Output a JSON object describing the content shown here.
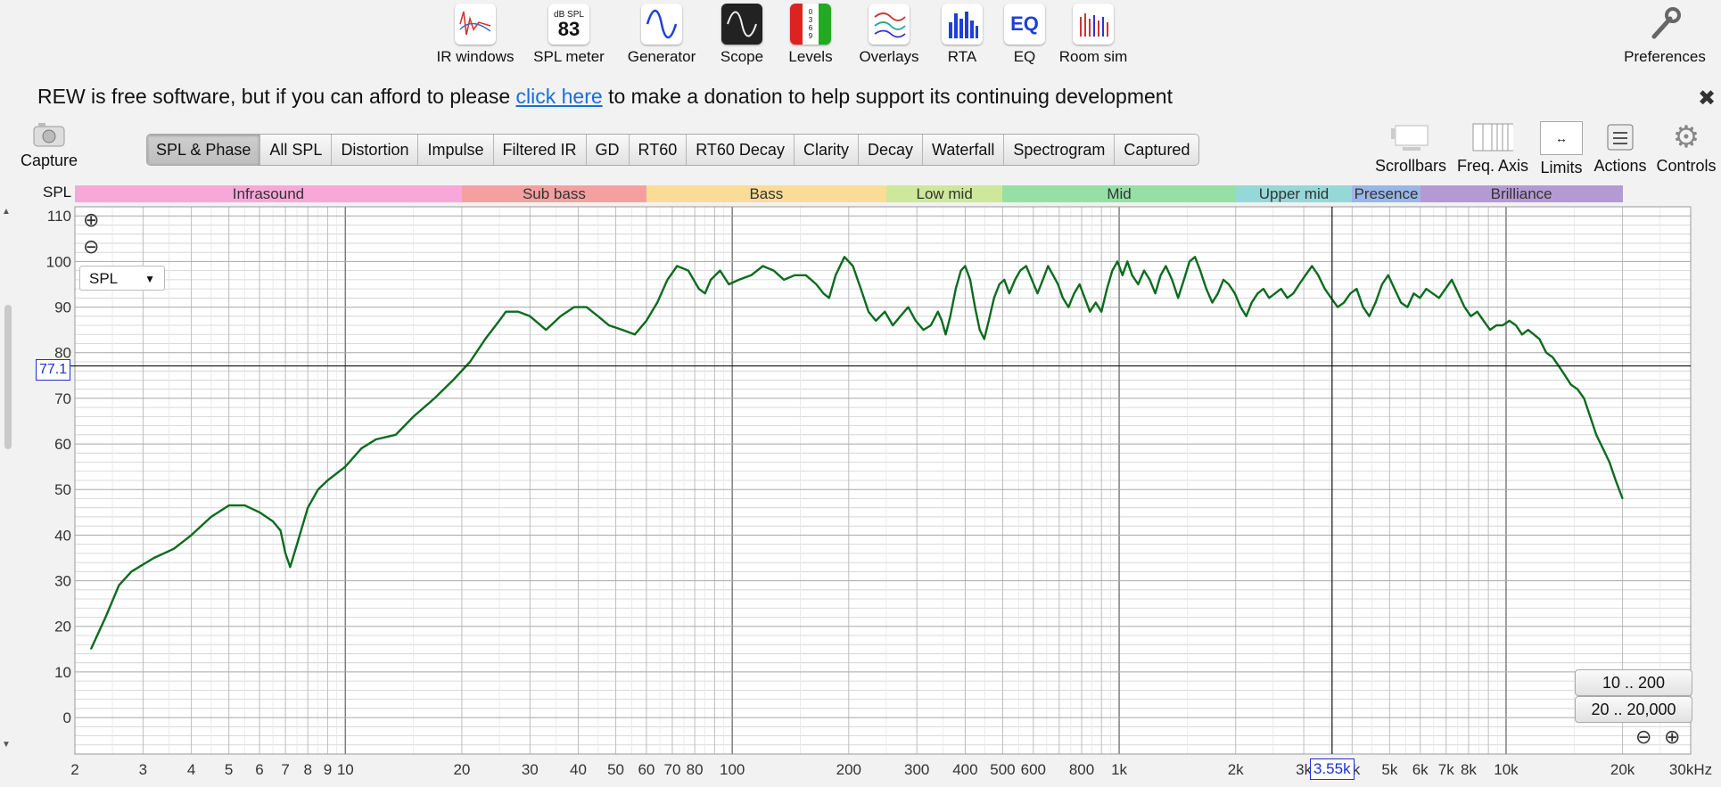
{
  "toolbar": {
    "items": [
      {
        "label": "IR windows",
        "icon": "ir-windows-icon"
      },
      {
        "label": "SPL meter",
        "icon": "spl-meter-icon",
        "icon_top": "dB SPL",
        "icon_value": "83"
      },
      {
        "label": "Generator",
        "icon": "generator-icon"
      },
      {
        "label": "Scope",
        "icon": "scope-icon"
      },
      {
        "label": "Levels",
        "icon": "levels-icon",
        "icon_digits": "0\n3\n6\n9"
      },
      {
        "label": "Overlays",
        "icon": "overlays-icon"
      },
      {
        "label": "RTA",
        "icon": "rta-icon"
      },
      {
        "label": "EQ",
        "icon": "eq-icon",
        "icon_text": "EQ"
      },
      {
        "label": "Room sim",
        "icon": "room-sim-icon"
      }
    ],
    "preferences": "Preferences"
  },
  "donation": {
    "before": "REW is free software, but if you can afford to please",
    "link": "click here",
    "after": "to make a donation to help support its continuing development"
  },
  "capture": {
    "label": "Capture"
  },
  "tabs": [
    "SPL & Phase",
    "All SPL",
    "Distortion",
    "Impulse",
    "Filtered IR",
    "GD",
    "RT60",
    "RT60 Decay",
    "Clarity",
    "Decay",
    "Waterfall",
    "Spectrogram",
    "Captured"
  ],
  "active_tab": "SPL & Phase",
  "right_tools": [
    "Scrollbars",
    "Freq. Axis",
    "Limits",
    "Actions",
    "Controls"
  ],
  "bands": [
    {
      "name": "Infrasound",
      "from": 2,
      "to": 20,
      "color": "#f7a8d8"
    },
    {
      "name": "Sub bass",
      "from": 20,
      "to": 60,
      "color": "#f5a0a0"
    },
    {
      "name": "Bass",
      "from": 60,
      "to": 250,
      "color": "#f9dd96"
    },
    {
      "name": "Low mid",
      "from": 250,
      "to": 500,
      "color": "#cde89a"
    },
    {
      "name": "Mid",
      "from": 500,
      "to": 2000,
      "color": "#96e0a6"
    },
    {
      "name": "Upper mid",
      "from": 2000,
      "to": 4000,
      "color": "#96d8d8"
    },
    {
      "name": "Presence",
      "from": 4000,
      "to": 6000,
      "color": "#9ab6e6"
    },
    {
      "name": "Brilliance",
      "from": 6000,
      "to": 20000,
      "color": "#b49ad2"
    }
  ],
  "axis_label_y": "SPL",
  "measurement_select": "SPL",
  "cursor": {
    "y_value": "77.1",
    "x_value": "3.55k"
  },
  "range_buttons": [
    "10 .. 200",
    "20 .. 20,000"
  ],
  "colors": {
    "curve": "#0d6b1f",
    "cursor": "#1a2fd8",
    "major_grid": "#777777",
    "minor_grid": "#cfcfcf"
  },
  "chart_data": {
    "type": "line",
    "title": "",
    "xlabel": "",
    "ylabel": "SPL",
    "x_scale": "log",
    "xlim": [
      2,
      30000
    ],
    "ylim": [
      -8,
      112
    ],
    "y_ticks": [
      0,
      10,
      20,
      30,
      40,
      50,
      60,
      70,
      80,
      90,
      100,
      110
    ],
    "x_tick_labels": [
      {
        "v": 2,
        "t": "2"
      },
      {
        "v": 3,
        "t": "3"
      },
      {
        "v": 4,
        "t": "4"
      },
      {
        "v": 5,
        "t": "5"
      },
      {
        "v": 6,
        "t": "6"
      },
      {
        "v": 7,
        "t": "7"
      },
      {
        "v": 8,
        "t": "8"
      },
      {
        "v": 9,
        "t": "9"
      },
      {
        "v": 10,
        "t": "10"
      },
      {
        "v": 20,
        "t": "20"
      },
      {
        "v": 30,
        "t": "30"
      },
      {
        "v": 40,
        "t": "40"
      },
      {
        "v": 50,
        "t": "50"
      },
      {
        "v": 60,
        "t": "60"
      },
      {
        "v": 70,
        "t": "70"
      },
      {
        "v": 80,
        "t": "80"
      },
      {
        "v": 100,
        "t": "100"
      },
      {
        "v": 200,
        "t": "200"
      },
      {
        "v": 300,
        "t": "300"
      },
      {
        "v": 400,
        "t": "400"
      },
      {
        "v": 500,
        "t": "500"
      },
      {
        "v": 600,
        "t": "600"
      },
      {
        "v": 800,
        "t": "800"
      },
      {
        "v": 1000,
        "t": "1k"
      },
      {
        "v": 2000,
        "t": "2k"
      },
      {
        "v": 3000,
        "t": "3k"
      },
      {
        "v": 4000,
        "t": "4k"
      },
      {
        "v": 5000,
        "t": "5k"
      },
      {
        "v": 6000,
        "t": "6k"
      },
      {
        "v": 7000,
        "t": "7k"
      },
      {
        "v": 8000,
        "t": "8k"
      },
      {
        "v": 10000,
        "t": "10k"
      },
      {
        "v": 20000,
        "t": "20k"
      },
      {
        "v": 30000,
        "t": "30kHz"
      }
    ],
    "cursor": {
      "x": 3550,
      "y": 77.1
    },
    "series": [
      {
        "points": [
          [
            2.2,
            15
          ],
          [
            2.4,
            22
          ],
          [
            2.6,
            29
          ],
          [
            2.8,
            32
          ],
          [
            3.2,
            35
          ],
          [
            3.6,
            37
          ],
          [
            4.0,
            40
          ],
          [
            4.5,
            44
          ],
          [
            5.0,
            46.5
          ],
          [
            5.5,
            46.5
          ],
          [
            6.0,
            45
          ],
          [
            6.5,
            43
          ],
          [
            6.8,
            41
          ],
          [
            7.0,
            36
          ],
          [
            7.2,
            33
          ],
          [
            7.5,
            38
          ],
          [
            8.0,
            46
          ],
          [
            8.5,
            50
          ],
          [
            9.0,
            52
          ],
          [
            10,
            55
          ],
          [
            11,
            59
          ],
          [
            12,
            61
          ],
          [
            13.5,
            62
          ],
          [
            15,
            66
          ],
          [
            17,
            70
          ],
          [
            19,
            74
          ],
          [
            21,
            78
          ],
          [
            23,
            83
          ],
          [
            25,
            87
          ],
          [
            26,
            89
          ],
          [
            28,
            89
          ],
          [
            30,
            88
          ],
          [
            33,
            85
          ],
          [
            36,
            88
          ],
          [
            39,
            90
          ],
          [
            42,
            90
          ],
          [
            45,
            88
          ],
          [
            48,
            86
          ],
          [
            52,
            85
          ],
          [
            56,
            84
          ],
          [
            60,
            87
          ],
          [
            64,
            91
          ],
          [
            68,
            96
          ],
          [
            72,
            99
          ],
          [
            77,
            98
          ],
          [
            82,
            94
          ],
          [
            85,
            93
          ],
          [
            88,
            96
          ],
          [
            93,
            98
          ],
          [
            98,
            95
          ],
          [
            104,
            96
          ],
          [
            112,
            97
          ],
          [
            120,
            99
          ],
          [
            128,
            98
          ],
          [
            136,
            96
          ],
          [
            145,
            97
          ],
          [
            155,
            97
          ],
          [
            165,
            95
          ],
          [
            172,
            93
          ],
          [
            178,
            92
          ],
          [
            185,
            97
          ],
          [
            195,
            101
          ],
          [
            205,
            99
          ],
          [
            215,
            94
          ],
          [
            225,
            89
          ],
          [
            235,
            87
          ],
          [
            248,
            89
          ],
          [
            260,
            86
          ],
          [
            272,
            88
          ],
          [
            285,
            90
          ],
          [
            298,
            87
          ],
          [
            312,
            85
          ],
          [
            326,
            86
          ],
          [
            340,
            89
          ],
          [
            348,
            87
          ],
          [
            356,
            84
          ],
          [
            366,
            88
          ],
          [
            378,
            94
          ],
          [
            390,
            98
          ],
          [
            400,
            99
          ],
          [
            412,
            96
          ],
          [
            424,
            90
          ],
          [
            436,
            85
          ],
          [
            448,
            83
          ],
          [
            460,
            87
          ],
          [
            475,
            92
          ],
          [
            490,
            95
          ],
          [
            505,
            96
          ],
          [
            520,
            93
          ],
          [
            538,
            96
          ],
          [
            555,
            98
          ],
          [
            575,
            99
          ],
          [
            595,
            96
          ],
          [
            615,
            93
          ],
          [
            635,
            96
          ],
          [
            655,
            99
          ],
          [
            675,
            97
          ],
          [
            695,
            95
          ],
          [
            715,
            92
          ],
          [
            740,
            90
          ],
          [
            765,
            93
          ],
          [
            790,
            95
          ],
          [
            815,
            92
          ],
          [
            840,
            89
          ],
          [
            870,
            91
          ],
          [
            900,
            89
          ],
          [
            930,
            94
          ],
          [
            960,
            98
          ],
          [
            990,
            100
          ],
          [
            1020,
            97
          ],
          [
            1050,
            100
          ],
          [
            1080,
            97
          ],
          [
            1120,
            95
          ],
          [
            1160,
            98
          ],
          [
            1200,
            96
          ],
          [
            1240,
            93
          ],
          [
            1280,
            97
          ],
          [
            1320,
            99
          ],
          [
            1370,
            96
          ],
          [
            1420,
            92
          ],
          [
            1470,
            96
          ],
          [
            1520,
            100
          ],
          [
            1570,
            101
          ],
          [
            1620,
            98
          ],
          [
            1680,
            94
          ],
          [
            1740,
            91
          ],
          [
            1800,
            93
          ],
          [
            1860,
            96
          ],
          [
            1920,
            95
          ],
          [
            1990,
            93
          ],
          [
            2060,
            90
          ],
          [
            2130,
            88
          ],
          [
            2200,
            91
          ],
          [
            2280,
            93
          ],
          [
            2360,
            94
          ],
          [
            2440,
            92
          ],
          [
            2530,
            93
          ],
          [
            2620,
            94
          ],
          [
            2720,
            92
          ],
          [
            2820,
            93
          ],
          [
            2920,
            95
          ],
          [
            3030,
            97
          ],
          [
            3150,
            99
          ],
          [
            3270,
            97
          ],
          [
            3400,
            94
          ],
          [
            3530,
            92
          ],
          [
            3670,
            90
          ],
          [
            3810,
            91
          ],
          [
            3960,
            93
          ],
          [
            4110,
            94
          ],
          [
            4270,
            90
          ],
          [
            4430,
            88
          ],
          [
            4600,
            91
          ],
          [
            4780,
            95
          ],
          [
            4960,
            97
          ],
          [
            5150,
            94
          ],
          [
            5350,
            91
          ],
          [
            5560,
            90
          ],
          [
            5770,
            93
          ],
          [
            5990,
            92
          ],
          [
            6220,
            94
          ],
          [
            6460,
            93
          ],
          [
            6710,
            92
          ],
          [
            6970,
            94
          ],
          [
            7240,
            96
          ],
          [
            7520,
            93
          ],
          [
            7810,
            90
          ],
          [
            8110,
            88
          ],
          [
            8420,
            89
          ],
          [
            8750,
            87
          ],
          [
            9090,
            85
          ],
          [
            9440,
            86
          ],
          [
            9800,
            86
          ],
          [
            10200,
            87
          ],
          [
            10600,
            86
          ],
          [
            11000,
            84
          ],
          [
            11400,
            85
          ],
          [
            11800,
            84
          ],
          [
            12200,
            83
          ],
          [
            12700,
            80
          ],
          [
            13200,
            79
          ],
          [
            13700,
            77
          ],
          [
            14200,
            75
          ],
          [
            14700,
            73
          ],
          [
            15300,
            72
          ],
          [
            15900,
            70
          ],
          [
            16500,
            66
          ],
          [
            17100,
            62
          ],
          [
            17800,
            59
          ],
          [
            18500,
            56
          ],
          [
            19200,
            52
          ],
          [
            20000,
            48
          ]
        ]
      }
    ]
  }
}
